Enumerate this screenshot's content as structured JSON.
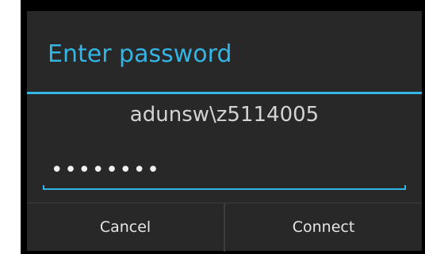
{
  "dialog": {
    "title": "Enter password",
    "username": "adunsw\\z5114005",
    "password_masked": "••••••••",
    "cancel_label": "Cancel",
    "connect_label": "Connect"
  },
  "colors": {
    "accent": "#33b5e5",
    "dialog_background": "#282828",
    "screen_background": "#000000",
    "text": "#e6e6e6"
  }
}
